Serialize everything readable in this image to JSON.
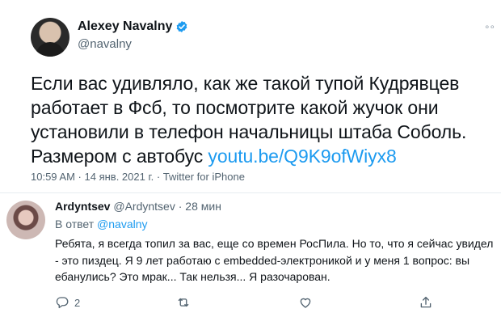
{
  "tweet": {
    "author_name": "Alexey Navalny",
    "handle": "@navalny",
    "text": "Если вас удивляло, как же такой тупой Кудрявцев работает в Фсб, то посмотрите какой жучок они установили в телефон начальницы штаба Соболь. Размером с автобус ",
    "link": "youtu.be/Q9K9ofWiyx8",
    "time": "10:59 AM",
    "date": "14 янв. 2021 г.",
    "source": "Twitter for iPhone",
    "meta_separator": " · ",
    "more_glyph": "∘∘"
  },
  "reply": {
    "author_name": "Ardyntsev",
    "handle": "@Ardyntsev",
    "separator": "·",
    "time": "28 мин",
    "reply_to_prefix": "В ответ ",
    "reply_to_handle": "@navalny",
    "text": "Ребята, я всегда топил за вас, еще со времен РосПила. Но то, что я сейчас увидел - это пиздец. Я 9 лет работаю с embedded-электроникой и у меня 1 вопрос: вы ебанулись? Это мрак... Так нельзя... Я разочарован.",
    "actions": {
      "reply_count": "2"
    }
  },
  "colors": {
    "link": "#1d9bf0",
    "secondary_text": "#536471",
    "primary_text": "#0f1419",
    "divider": "#e6ecf0"
  },
  "icons": [
    "verified-badge-icon",
    "more-icon",
    "reply-icon",
    "retweet-icon",
    "like-icon",
    "share-icon"
  ]
}
